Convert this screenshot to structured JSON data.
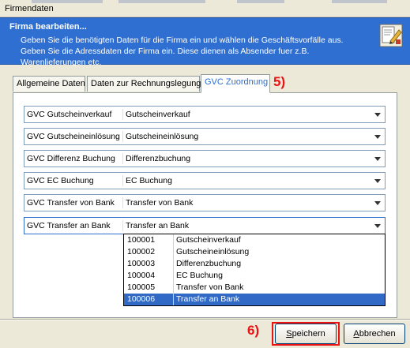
{
  "window": {
    "title": "Firmendaten"
  },
  "banner": {
    "title": "Firma bearbeiten...",
    "text": "Geben Sie die benötigten Daten für die Firma ein und wählen die Geschäftsvorfälle aus. Geben Sie die Adressdaten der Firma ein. Diese dienen als Absender fuer z.B. Warenlieferungen etc.",
    "icon": "edit-document-icon"
  },
  "tabs": [
    {
      "label": "Allgemeine Daten"
    },
    {
      "label": "Daten zur Rechnungslegung"
    },
    {
      "label": "GVC Zuordnung",
      "active": true
    }
  ],
  "annotations": {
    "tab_marker": "5)",
    "save_marker": "6)"
  },
  "rows": [
    {
      "label": "GVC Gutscheinverkauf",
      "value": "Gutscheinverkauf"
    },
    {
      "label": "GVC Gutscheineinlösung",
      "value": "Gutscheineinlösung"
    },
    {
      "label": "GVC Differenz Buchung",
      "value": "Differenzbuchung"
    },
    {
      "label": "GVC EC Buchung",
      "value": "EC Buchung"
    },
    {
      "label": "GVC Transfer von Bank",
      "value": "Transfer von Bank"
    },
    {
      "label": "GVC Transfer an Bank",
      "value": "Transfer an Bank"
    }
  ],
  "dropdown": {
    "items": [
      {
        "code": "100001",
        "name": "Gutscheinverkauf"
      },
      {
        "code": "100002",
        "name": "Gutscheineinlösung"
      },
      {
        "code": "100003",
        "name": "Differenzbuchung"
      },
      {
        "code": "100004",
        "name": "EC Buchung"
      },
      {
        "code": "100005",
        "name": "Transfer von Bank"
      },
      {
        "code": "100006",
        "name": "Transfer an Bank",
        "selected": true
      }
    ]
  },
  "buttons": {
    "save_first": "S",
    "save_rest": "peichern",
    "cancel_first": "A",
    "cancel_rest": "bbrechen"
  },
  "colors": {
    "banner": "#2f6fd1",
    "highlight": "#ee1111",
    "selection": "#3169c6",
    "active_tab_text": "#2a6fd2"
  }
}
